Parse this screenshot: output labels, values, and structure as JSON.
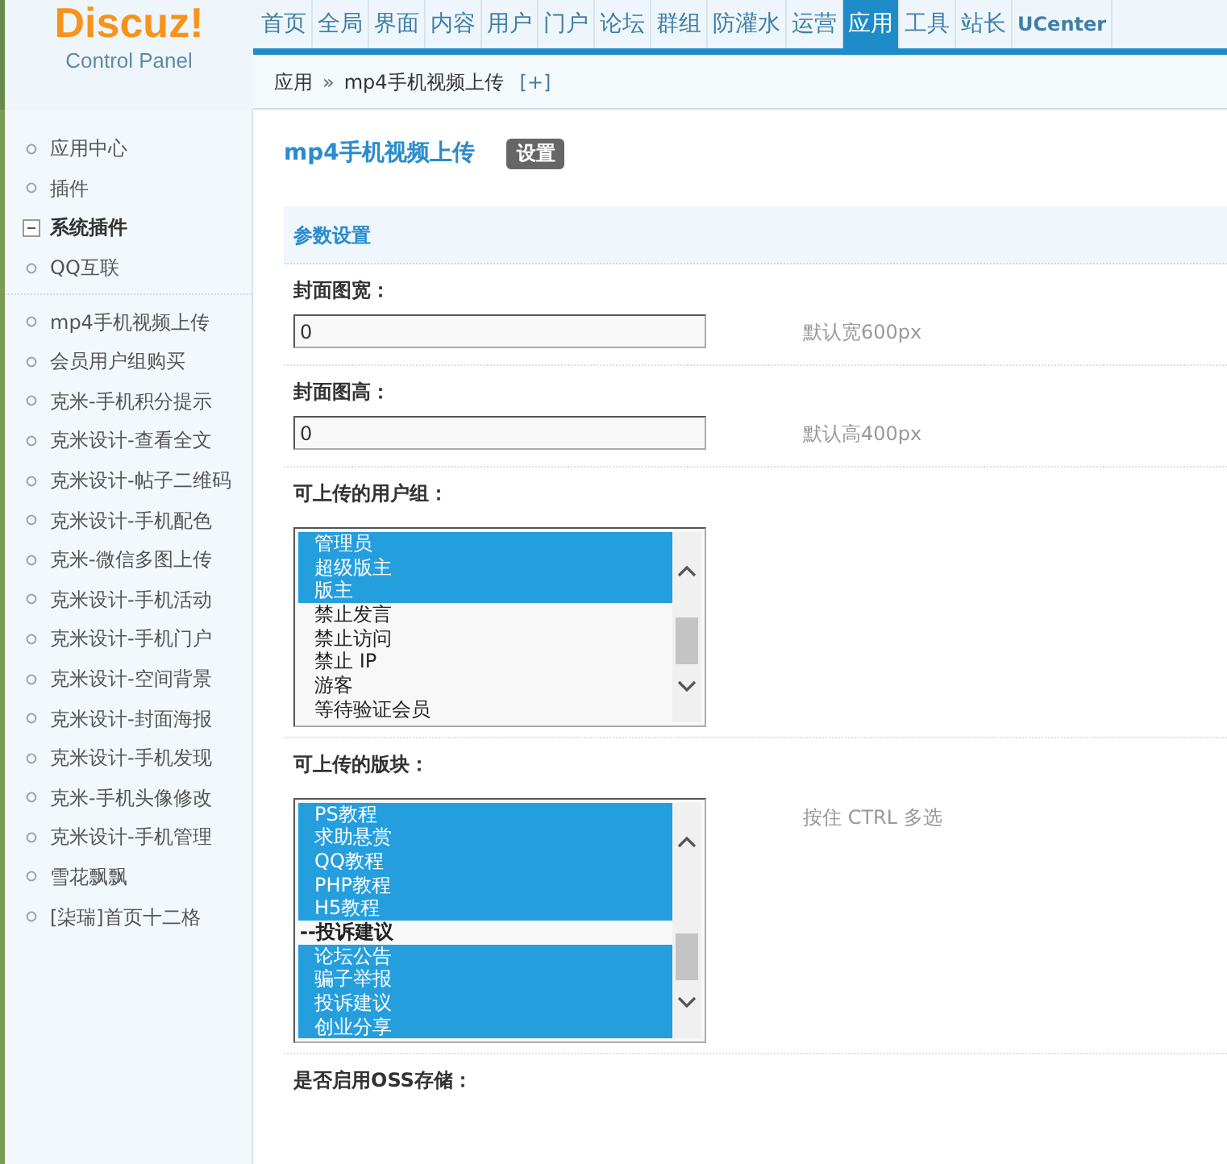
{
  "header": {
    "logo": "Discuz!",
    "subtitle": "Control Panel",
    "nav": [
      {
        "label": "首页",
        "selected": false
      },
      {
        "label": "全局",
        "selected": false
      },
      {
        "label": "界面",
        "selected": false
      },
      {
        "label": "内容",
        "selected": false
      },
      {
        "label": "用户",
        "selected": false
      },
      {
        "label": "门户",
        "selected": false
      },
      {
        "label": "论坛",
        "selected": false
      },
      {
        "label": "群组",
        "selected": false
      },
      {
        "label": "防灌水",
        "selected": false
      },
      {
        "label": "运营",
        "selected": false
      },
      {
        "label": "应用",
        "selected": true
      },
      {
        "label": "工具",
        "selected": false
      },
      {
        "label": "站长",
        "selected": false
      },
      {
        "label": "UCenter",
        "selected": false
      }
    ]
  },
  "breadcrumb": {
    "items": [
      "应用",
      "mp4手机视频上传"
    ],
    "separator": "»",
    "add": "[+]"
  },
  "sidebar": {
    "top_items": [
      {
        "kind": "link",
        "label": "应用中心"
      },
      {
        "kind": "link",
        "label": "插件"
      },
      {
        "kind": "group",
        "label": "系统插件",
        "expanded": true
      },
      {
        "kind": "link",
        "label": "QQ互联"
      }
    ],
    "plugins": [
      {
        "kind": "link",
        "label": "mp4手机视频上传"
      },
      {
        "kind": "link",
        "label": "会员用户组购买"
      },
      {
        "kind": "link",
        "label": "克米-手机积分提示"
      },
      {
        "kind": "link",
        "label": "克米设计-查看全文"
      },
      {
        "kind": "link",
        "label": "克米设计-帖子二维码"
      },
      {
        "kind": "link",
        "label": "克米设计-手机配色"
      },
      {
        "kind": "link",
        "label": "克米-微信多图上传"
      },
      {
        "kind": "link",
        "label": "克米设计-手机活动"
      },
      {
        "kind": "link",
        "label": "克米设计-手机门户"
      },
      {
        "kind": "link",
        "label": "克米设计-空间背景"
      },
      {
        "kind": "link",
        "label": "克米设计-封面海报"
      },
      {
        "kind": "link",
        "label": "克米设计-手机发现"
      },
      {
        "kind": "link",
        "label": "克米-手机头像修改"
      },
      {
        "kind": "link",
        "label": "克米设计-手机管理"
      },
      {
        "kind": "link",
        "label": "雪花飘飘"
      },
      {
        "kind": "link",
        "label": "[柒瑞]首页十二格"
      }
    ]
  },
  "page": {
    "title": "mp4手机视频上传",
    "settings_button": "设置"
  },
  "section": {
    "title": "参数设置"
  },
  "fields": [
    {
      "kind": "text",
      "label": "封面图宽：",
      "value": "0",
      "hint": "默认宽600px"
    },
    {
      "kind": "text",
      "label": "封面图高：",
      "value": "0",
      "hint": "默认高400px"
    },
    {
      "kind": "multiselect",
      "label": "可上传的用户组：",
      "options": [
        {
          "kind": "option",
          "label": "管理员",
          "selected": true
        },
        {
          "kind": "option",
          "label": "超级版主",
          "selected": true
        },
        {
          "kind": "option",
          "label": "版主",
          "selected": true
        },
        {
          "kind": "option",
          "label": "禁止发言",
          "selected": false
        },
        {
          "kind": "option",
          "label": "禁止访问",
          "selected": false
        },
        {
          "kind": "option",
          "label": "禁止 IP",
          "selected": false
        },
        {
          "kind": "option",
          "label": "游客",
          "selected": false
        },
        {
          "kind": "option",
          "label": "等待验证会员",
          "selected": false
        }
      ]
    },
    {
      "kind": "multiselect",
      "label": "可上传的版块：",
      "hint": "按住 CTRL 多选",
      "options": [
        {
          "kind": "option",
          "label": "PS教程",
          "selected": true
        },
        {
          "kind": "option",
          "label": "求助悬赏",
          "selected": true
        },
        {
          "kind": "option",
          "label": "QQ教程",
          "selected": true
        },
        {
          "kind": "option",
          "label": "PHP教程",
          "selected": true
        },
        {
          "kind": "option",
          "label": "H5教程",
          "selected": true
        },
        {
          "kind": "group",
          "label": "--投诉建议",
          "selected": false
        },
        {
          "kind": "option",
          "label": "论坛公告",
          "selected": true
        },
        {
          "kind": "option",
          "label": "骗子举报",
          "selected": true
        },
        {
          "kind": "option",
          "label": "投诉建议",
          "selected": true
        },
        {
          "kind": "option",
          "label": "创业分享",
          "selected": true
        }
      ]
    },
    {
      "kind": "label_only",
      "label": "是否启用OSS存储："
    }
  ]
}
